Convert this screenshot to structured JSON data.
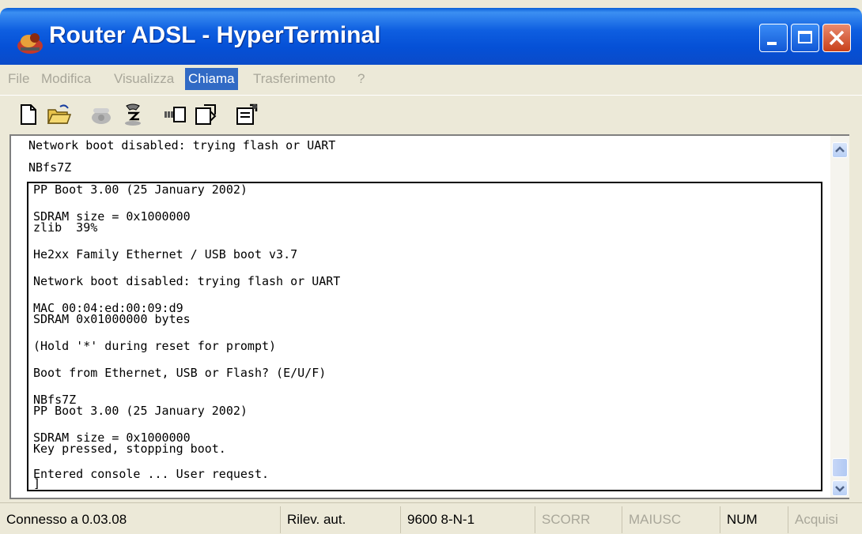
{
  "window": {
    "title": "Router ADSL - HyperTerminal"
  },
  "menu": {
    "items": [
      {
        "label": "File",
        "active": false
      },
      {
        "label": "Modifica",
        "active": false
      },
      {
        "label": "Visualizza",
        "active": false
      },
      {
        "label": "Chiama",
        "active": true
      },
      {
        "label": "Trasferimento",
        "active": false
      },
      {
        "label": "?",
        "active": false
      }
    ]
  },
  "toolbar": {
    "buttons": [
      "new-document-icon",
      "open-folder-icon",
      "call-phone-icon",
      "disconnect-icon",
      "send-icon",
      "receive-icon",
      "properties-icon"
    ]
  },
  "terminal": {
    "outer_lines": [
      "Network boot disabled: trying flash or UART",
      "NBfs7Z"
    ],
    "inner_lines": [
      "PP Boot 3.00 (25 January 2002)",
      "SDRAM size = 0x1000000",
      "zlib  39%",
      "He2xx Family Ethernet / USB boot v3.7",
      "Network boot disabled: trying flash or UART",
      "MAC 00:04:ed:00:09:d9",
      "SDRAM 0x01000000 bytes",
      "(Hold '*' during reset for prompt)",
      "Boot from Ethernet, USB or Flash? (E/U/F)",
      "NBfs7Z",
      "PP Boot 3.00 (25 January 2002)",
      "SDRAM size = 0x1000000",
      "Key pressed, stopping boot.",
      "Entered console ... User request.",
      "]"
    ]
  },
  "status": {
    "connection": "Connesso a 0.03.08",
    "detect": "Rilev. aut.",
    "settings": "9600 8-N-1",
    "scroll": "SCORR",
    "caps": "MAIUSC",
    "num": "NUM",
    "capture": "Acquisi"
  },
  "colors": {
    "titlebar": "#0550d6",
    "menu_active": "#316ac5",
    "close_button": "#c8401a"
  }
}
